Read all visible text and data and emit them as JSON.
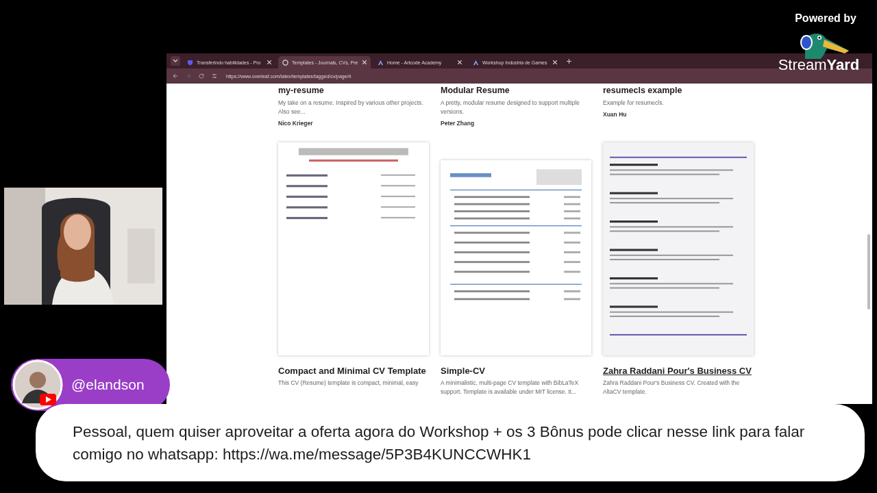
{
  "branding": {
    "powered_by": "Powered by",
    "logo_text_light": "Stream",
    "logo_text_bold": "Yard"
  },
  "browser": {
    "tabs": [
      {
        "kind": "shield",
        "label": "Transferindo habilidades - Pro",
        "selected": false
      },
      {
        "kind": "globe",
        "label": "Templates - Journals, CVs, Pre",
        "selected": true
      },
      {
        "kind": "triangle",
        "label": "Home - Artcode Academy",
        "selected": false
      },
      {
        "kind": "triangle",
        "label": "Workshop Indústria de Games",
        "selected": false
      }
    ],
    "url": "https://www.overleaf.com/latex/templates/tagged/cv/page/4"
  },
  "templates_top": [
    {
      "title": "my-resume",
      "description": "My take on a resume. Inspired by various other projects. Also see...",
      "author": "Nico Krieger"
    },
    {
      "title": "Modular Resume",
      "description": "A pretty, modular resume designed to support multiple versions.",
      "author": "Peter Zhang"
    },
    {
      "title": "resumecls example",
      "description": "Example for resumecls.",
      "author": "Xuan Hu"
    }
  ],
  "templates_bottom": [
    {
      "kind": "picture",
      "title": "Compact and Minimal CV Template",
      "description": "This CV (Resume) template is compact, minimal, easy",
      "underlined": false
    },
    {
      "kind": "picture",
      "title": "Simple-CV",
      "description": "A minimalistic, multi-page CV template with BibLaTeX support. Template is available under MIT license. It...",
      "underlined": false
    },
    {
      "kind": "picture",
      "title": "Zahra Raddani Pour's Business CV",
      "description": "Zahra Raddani Pour's Business CV. Created with the AltaCV template.",
      "underlined": true
    }
  ],
  "guest": {
    "handle": "@elandson"
  },
  "caption": "Pessoal, quem quiser aproveitar a oferta agora do Workshop + os 3 Bônus pode clicar nesse link para falar comigo no whatsapp: https://wa.me/message/5P3B4KUNCCWHK1"
}
